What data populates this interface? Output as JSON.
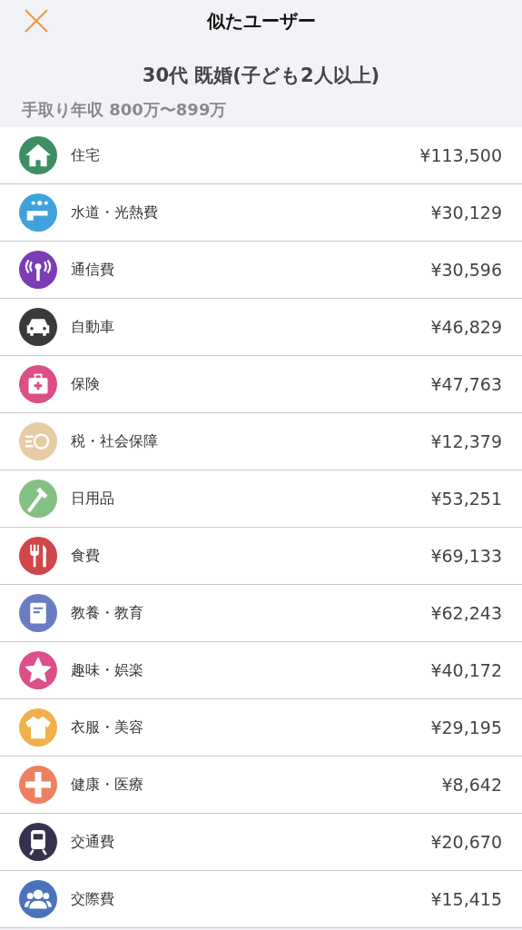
{
  "header": {
    "title": "似たユーザー",
    "subtitle": "30代 既婚(子ども2人以上)",
    "income": "手取り年収 800万〜899万"
  },
  "categories": [
    {
      "kind": "house",
      "color": "#3e8e64",
      "name": "住宅",
      "amount": "¥113,500"
    },
    {
      "kind": "faucet",
      "color": "#3fa2dc",
      "name": "水道・光熱費",
      "amount": "¥30,129"
    },
    {
      "kind": "antenna",
      "color": "#7a3db5",
      "name": "通信費",
      "amount": "¥30,596"
    },
    {
      "kind": "car",
      "color": "#3a3a3c",
      "name": "自動車",
      "amount": "¥46,829"
    },
    {
      "kind": "medkit",
      "color": "#db4f86",
      "name": "保険",
      "amount": "¥47,763"
    },
    {
      "kind": "coin",
      "color": "#e6cba6",
      "name": "税・社会保障",
      "amount": "¥12,379"
    },
    {
      "kind": "toothbrush",
      "color": "#84c084",
      "name": "日用品",
      "amount": "¥53,251"
    },
    {
      "kind": "cutlery",
      "color": "#d0464a",
      "name": "食費",
      "amount": "¥69,133"
    },
    {
      "kind": "book",
      "color": "#6b7dc2",
      "name": "教養・教育",
      "amount": "¥62,243"
    },
    {
      "kind": "star",
      "color": "#dd4f8a",
      "name": "趣味・娯楽",
      "amount": "¥40,172"
    },
    {
      "kind": "shirt",
      "color": "#f1b14a",
      "name": "衣服・美容",
      "amount": "¥29,195"
    },
    {
      "kind": "cross",
      "color": "#ee8062",
      "name": "健康・医療",
      "amount": "¥8,642"
    },
    {
      "kind": "train",
      "color": "#35324f",
      "name": "交通費",
      "amount": "¥20,670"
    },
    {
      "kind": "people",
      "color": "#4a73bb",
      "name": "交際費",
      "amount": "¥15,415"
    }
  ]
}
